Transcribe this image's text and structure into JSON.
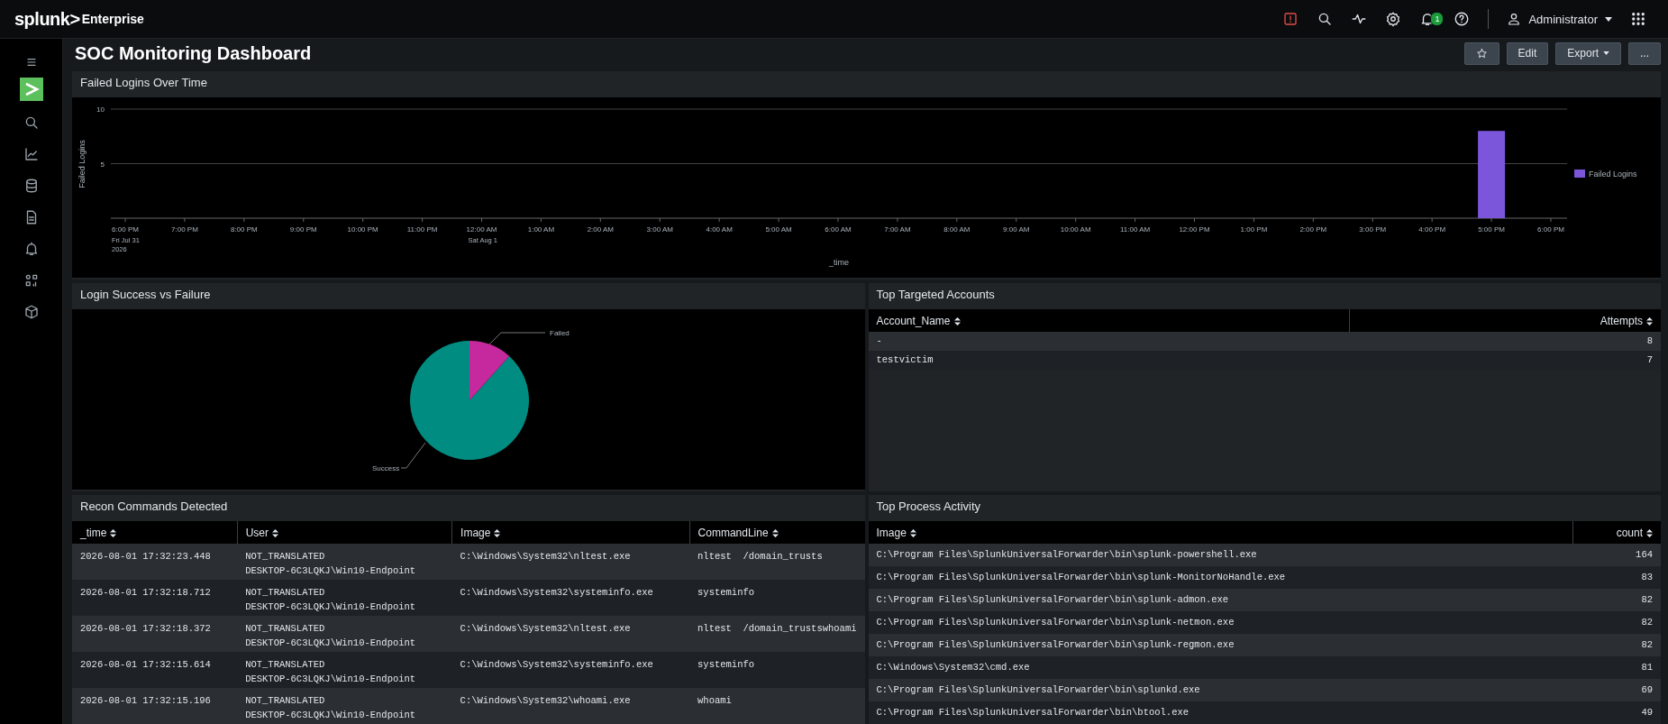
{
  "topbar": {
    "logo": "splunk>",
    "product": "Enterprise",
    "notification_count": "1",
    "user": "Administrator"
  },
  "dashboard": {
    "title": "SOC Monitoring Dashboard",
    "buttons": [
      "Edit",
      "Export"
    ],
    "more": "..."
  },
  "failed_logins_panel": {
    "title": "Failed Logins Over Time",
    "chart_data": {
      "type": "bar",
      "xlabel": "_time",
      "ylabel": "Failed Logins",
      "categories": [
        "6:00 PM",
        "7:00 PM",
        "8:00 PM",
        "9:00 PM",
        "10:00 PM",
        "11:00 PM",
        "12:00 AM",
        "1:00 AM",
        "2:00 AM",
        "3:00 AM",
        "4:00 AM",
        "5:00 AM",
        "6:00 AM",
        "7:00 AM",
        "8:00 AM",
        "9:00 AM",
        "10:00 AM",
        "11:00 AM",
        "12:00 PM",
        "1:00 PM",
        "2:00 PM",
        "3:00 PM",
        "4:00 PM",
        "5:00 PM",
        "6:00 PM"
      ],
      "series": [
        {
          "name": "Failed Logins",
          "color": "#7b56db",
          "values": [
            0,
            0,
            0,
            0,
            0,
            0,
            0,
            0,
            0,
            0,
            0,
            0,
            0,
            0,
            0,
            0,
            0,
            0,
            0,
            0,
            0,
            0,
            0,
            8,
            0
          ]
        }
      ],
      "ylim": [
        0,
        10
      ],
      "yticks": [
        5,
        10
      ],
      "annotations": [
        "Fri Jul 31",
        "2026",
        "Sat Aug 1"
      ]
    }
  },
  "login_pie_panel": {
    "title": "Login Success vs Failure",
    "slices": [
      {
        "label": "Failed",
        "color": "#c6289d"
      },
      {
        "label": "Success",
        "color": "#008c80"
      }
    ]
  },
  "accounts_panel": {
    "title": "Top Targeted Accounts",
    "columns": [
      {
        "label": "Account_Name",
        "kind": "text"
      },
      {
        "label": "Attempts",
        "kind": "number"
      }
    ],
    "rows": [
      [
        "-",
        "8"
      ],
      [
        "testvictim",
        "7"
      ]
    ]
  },
  "recon_panel": {
    "title": "Recon Commands Detected",
    "columns": [
      {
        "label": "_time",
        "kind": "text"
      },
      {
        "label": "User",
        "kind": "text"
      },
      {
        "label": "Image",
        "kind": "text"
      },
      {
        "label": "CommandLine",
        "kind": "text"
      }
    ],
    "rows": [
      [
        "2026-08-01 17:32:23.448",
        [
          "NOT_TRANSLATED",
          "DESKTOP-6C3LQKJ\\Win10-Endpoint"
        ],
        "C:\\Windows\\System32\\nltest.exe",
        "nltest  /domain_trusts"
      ],
      [
        "2026-08-01 17:32:18.712",
        [
          "NOT_TRANSLATED",
          "DESKTOP-6C3LQKJ\\Win10-Endpoint"
        ],
        "C:\\Windows\\System32\\systeminfo.exe",
        "systeminfo"
      ],
      [
        "2026-08-01 17:32:18.372",
        [
          "NOT_TRANSLATED",
          "DESKTOP-6C3LQKJ\\Win10-Endpoint"
        ],
        "C:\\Windows\\System32\\nltest.exe",
        "nltest  /domain_trustswhoami"
      ],
      [
        "2026-08-01 17:32:15.614",
        [
          "NOT_TRANSLATED",
          "DESKTOP-6C3LQKJ\\Win10-Endpoint"
        ],
        "C:\\Windows\\System32\\systeminfo.exe",
        "systeminfo"
      ],
      [
        "2026-08-01 17:32:15.196",
        [
          "NOT_TRANSLATED",
          "DESKTOP-6C3LQKJ\\Win10-Endpoint"
        ],
        "C:\\Windows\\System32\\whoami.exe",
        "whoami"
      ]
    ]
  },
  "process_panel": {
    "title": "Top Process Activity",
    "columns": [
      {
        "label": "Image",
        "kind": "text"
      },
      {
        "label": "count",
        "kind": "number"
      }
    ],
    "rows": [
      [
        "C:\\Program Files\\SplunkUniversalForwarder\\bin\\splunk-powershell.exe",
        "164"
      ],
      [
        "C:\\Program Files\\SplunkUniversalForwarder\\bin\\splunk-MonitorNoHandle.exe",
        "83"
      ],
      [
        "C:\\Program Files\\SplunkUniversalForwarder\\bin\\splunk-admon.exe",
        "82"
      ],
      [
        "C:\\Program Files\\SplunkUniversalForwarder\\bin\\splunk-netmon.exe",
        "82"
      ],
      [
        "C:\\Program Files\\SplunkUniversalForwarder\\bin\\splunk-regmon.exe",
        "82"
      ],
      [
        "C:\\Windows\\System32\\cmd.exe",
        "81"
      ],
      [
        "C:\\Program Files\\SplunkUniversalForwarder\\bin\\splunkd.exe",
        "69"
      ],
      [
        "C:\\Program Files\\SplunkUniversalForwarder\\bin\\btool.exe",
        "49"
      ]
    ]
  }
}
